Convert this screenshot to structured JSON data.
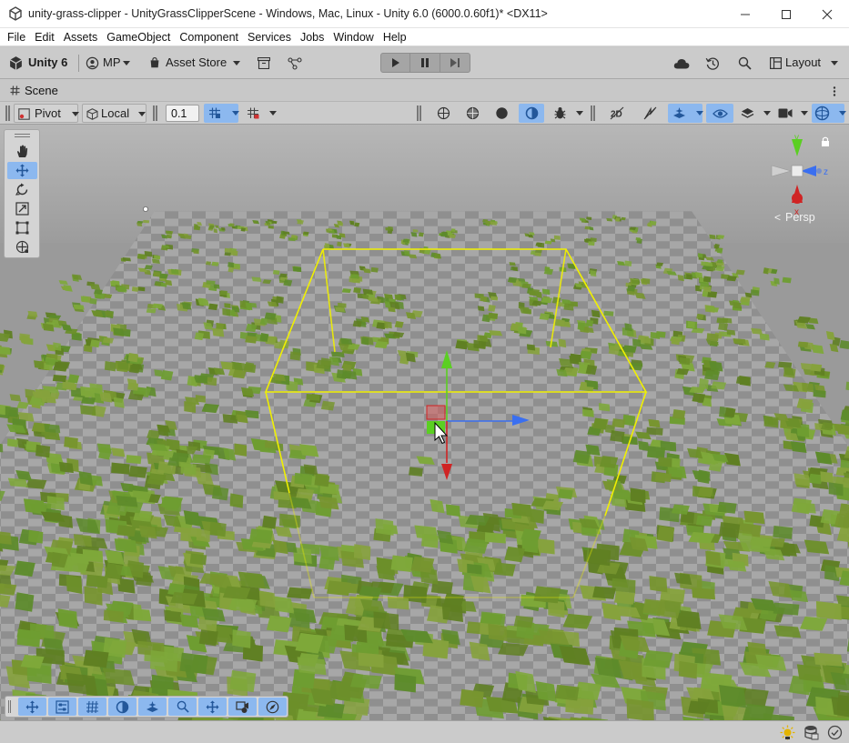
{
  "window": {
    "title": "unity-grass-clipper - UnityGrassClipperScene - Windows, Mac, Linux - Unity 6.0 (6000.0.60f1)* <DX11>"
  },
  "menu": [
    "File",
    "Edit",
    "Assets",
    "GameObject",
    "Component",
    "Services",
    "Jobs",
    "Window",
    "Help"
  ],
  "toolbar": {
    "unity_label": "Unity 6",
    "account_label": "MP",
    "asset_store_label": "Asset Store",
    "layout_label": "Layout"
  },
  "scene_tab": {
    "label": "Scene"
  },
  "scene_toolbar": {
    "pivot_label": "Pivot",
    "space_label": "Local",
    "snap_value": "0.1"
  },
  "gizmo": {
    "axis_y": "y",
    "axis_z": "z",
    "axis_x": "x",
    "projection_label": "Persp"
  },
  "colors": {
    "accent": "#8cb8ef",
    "selection_bounds": "#f0f000",
    "grass_light": "#6e9d31",
    "grass_dark": "#5f7f22",
    "axis_x": "#d02424",
    "axis_y": "#5bcf22",
    "axis_z": "#3a6ff0"
  }
}
